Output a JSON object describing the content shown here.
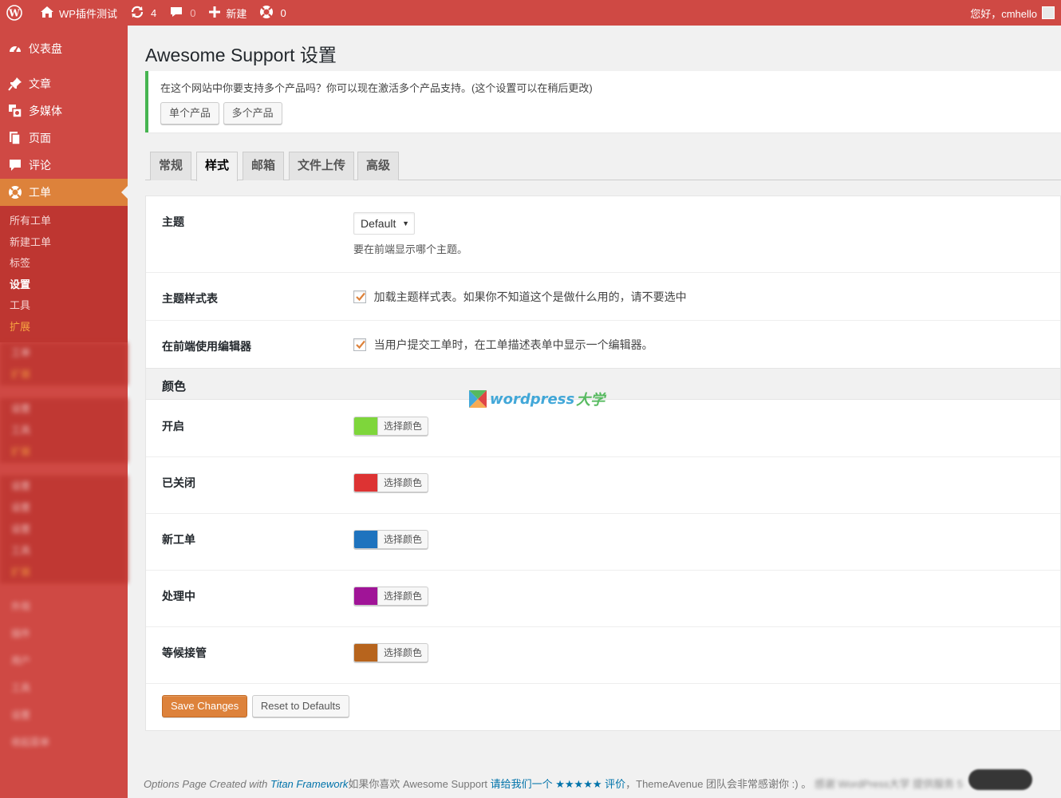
{
  "adminbar": {
    "site_name": "WP插件测试",
    "updates_count": "4",
    "comments_count": "0",
    "new_label": "新建",
    "support_count": "0",
    "greeting": "您好，cmhello"
  },
  "sidebar": {
    "items": [
      {
        "label": "仪表盘",
        "icon": "dashboard-icon"
      },
      {
        "label": "文章",
        "icon": "pin-icon"
      },
      {
        "label": "多媒体",
        "icon": "media-icon"
      },
      {
        "label": "页面",
        "icon": "page-icon"
      },
      {
        "label": "评论",
        "icon": "comment-icon"
      },
      {
        "label": "工单",
        "icon": "lifebuoy-icon"
      }
    ],
    "submenu": [
      "所有工单",
      "新建工单",
      "标签",
      "设置",
      "工具",
      "扩展"
    ],
    "blurred_rows": [
      "工单",
      "扩展",
      "设置",
      "工具",
      "扩展",
      "设置",
      "设置",
      "设置",
      "工具",
      "扩展",
      "外观",
      "插件",
      "用户",
      "工具",
      "设置",
      "收起菜单"
    ]
  },
  "colors": {
    "accent": "#cf4944",
    "current_menu": "#dd823b",
    "notice_border": "#46b450",
    "open": "#7ed63b",
    "closed": "#dd3333",
    "new": "#1e73be",
    "in_progress": "#a01497",
    "on_hold": "#b7641d"
  },
  "page": {
    "title": "Awesome Support 设置",
    "notice_text": "在这个网站中你要支持多个产品吗？你可以现在激活多个产品支持。(这个设置可以在稍后更改)",
    "single_product": "单个产品",
    "multiple_products": "多个产品"
  },
  "tabs": [
    "常规",
    "样式",
    "邮箱",
    "文件上传",
    "高级"
  ],
  "settings": {
    "theme_label": "主题",
    "theme_value": "Default",
    "theme_desc": "要在前端显示哪个主题。",
    "stylesheet_label": "主题样式表",
    "stylesheet_text": "加载主题样式表。如果你不知道这个是做什么用的，请不要选中",
    "editor_label": "在前端使用编辑器",
    "editor_text": "当用户提交工单时，在工单描述表单中显示一个编辑器。",
    "colors_heading": "颜色",
    "color_rows": [
      {
        "label": "开启",
        "button": "选择颜色",
        "color": "#7ed63b"
      },
      {
        "label": "已关闭",
        "button": "选择颜色",
        "color": "#dd3333"
      },
      {
        "label": "新工单",
        "button": "选择颜色",
        "color": "#1e73be"
      },
      {
        "label": "处理中",
        "button": "选择颜色",
        "color": "#a01497"
      },
      {
        "label": "等候接管",
        "button": "选择颜色",
        "color": "#b7641d"
      }
    ],
    "save": "Save Changes",
    "reset": "Reset to Defaults"
  },
  "watermark": {
    "text1": "wordpress",
    "text2": "大学"
  },
  "footer": {
    "created_with": "Options Page Created with",
    "titan_link": "Titan Framework",
    "like_text": "如果你喜欢 Awesome Support ",
    "rate_link": "请给我们一个 ★★★★★ 评价",
    "thanks": "，ThemeAvenue 团队会非常感谢你 :) 。",
    "blurred": "感谢 WordPress大学 提供服务 5"
  }
}
